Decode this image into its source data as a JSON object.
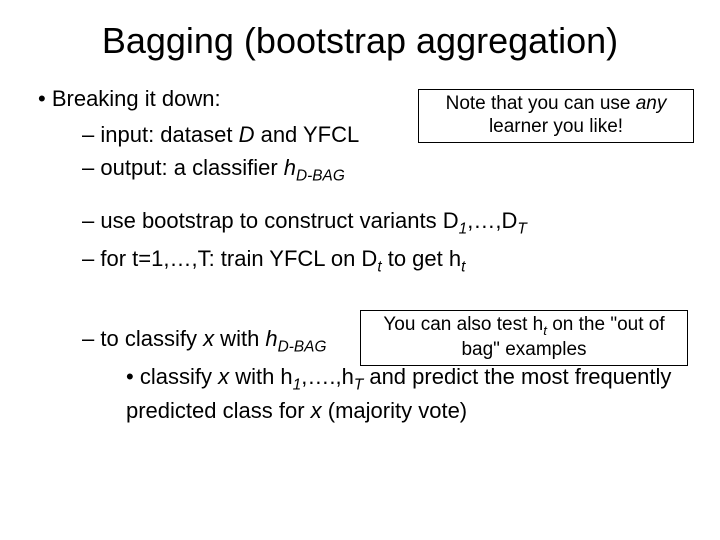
{
  "title": "Bagging (bootstrap aggregation)",
  "heading": "Breaking it down:",
  "note1_a": "Note that you can use ",
  "note1_any": "any",
  "note1_b": " learner you like!",
  "note2_a": "You can also test h",
  "note2_sub": "t",
  "note2_b": " on the \"out of bag\" examples",
  "l1_a": "input: dataset ",
  "l1_D": "D",
  "l1_b": " and YFCL",
  "l2_a": "output: a classifier ",
  "l2_h": "h",
  "l2_sub": "D-BAG",
  "l3_a": "use bootstrap to construct variants D",
  "l3_s1": "1",
  "l3_b": ",…,D",
  "l3_s2": "T",
  "l4_a": "for t=1,…,T: train YFCL on D",
  "l4_s1": "t",
  "l4_b": " to get h",
  "l4_s2": "t",
  "l5_a": "to classify ",
  "l5_x": "x",
  "l5_b": " with ",
  "l5_h": "h",
  "l5_sub": "D-BAG",
  "l6_a": "classify ",
  "l6_x": "x",
  "l6_b": " with h",
  "l6_s1": "1",
  "l6_c": ",….,h",
  "l6_s2": "T",
  "l6_d": " and predict the most frequently predicted class for ",
  "l6_x2": "x ",
  "l6_e": "(majority vote)"
}
